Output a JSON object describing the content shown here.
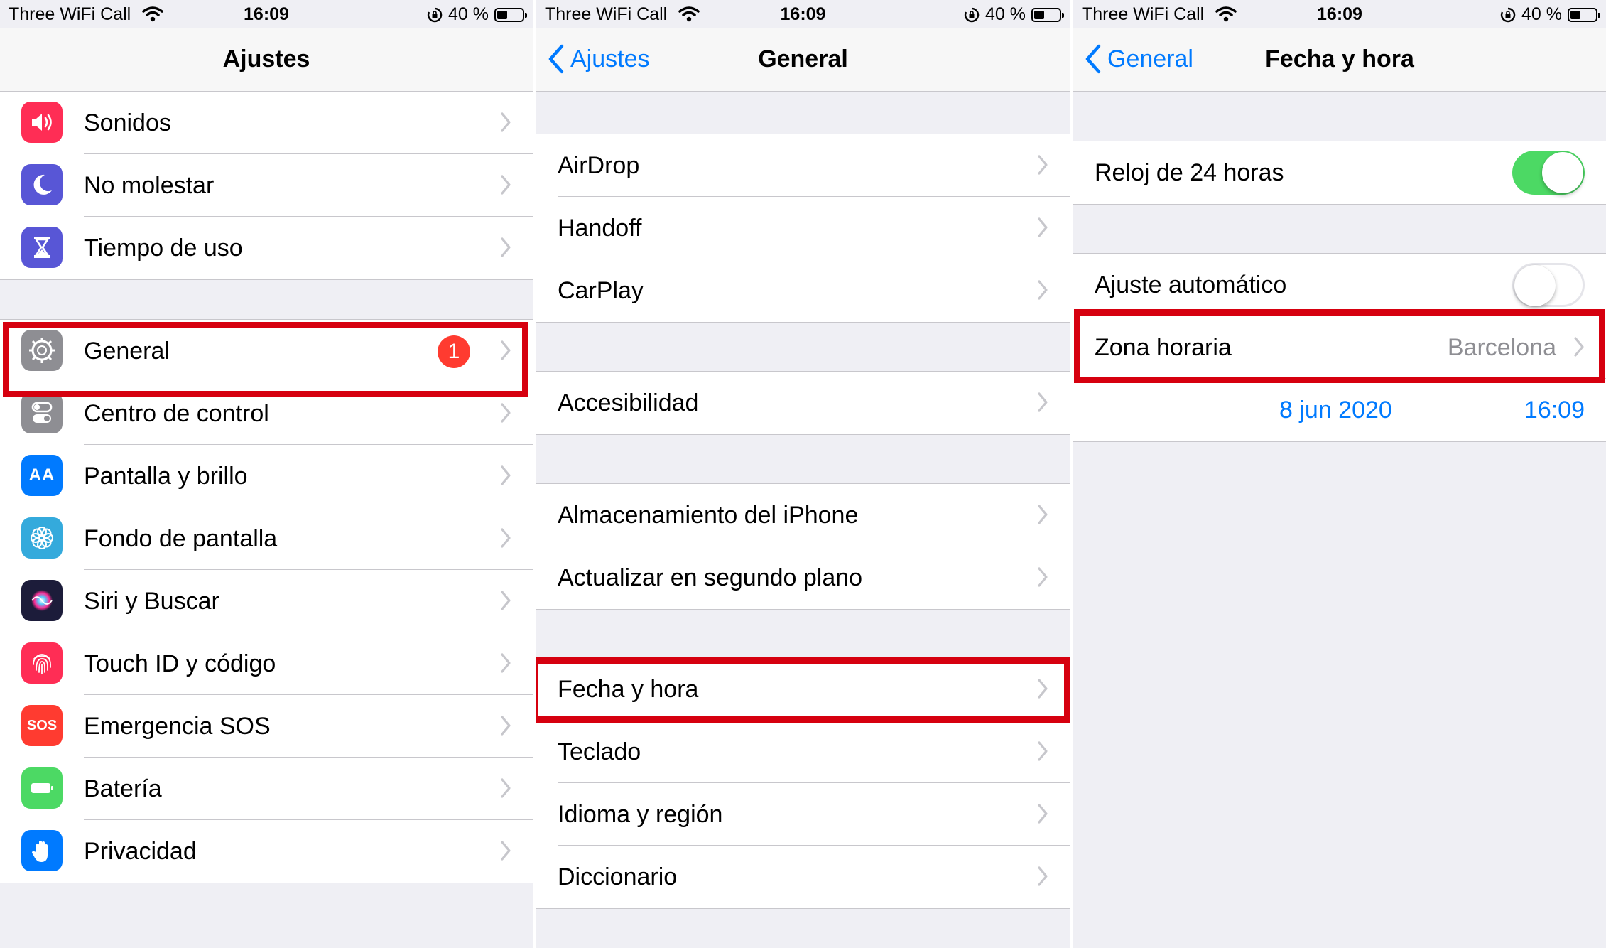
{
  "status": {
    "carrier": "Three WiFi Call",
    "time": "16:09",
    "battery": "40 %",
    "battery_level": 0.4
  },
  "screens": {
    "settings": {
      "title": "Ajustes",
      "group1": [
        {
          "label": "Sonidos",
          "icon": "speaker-icon",
          "color": "#ff2d55"
        },
        {
          "label": "No molestar",
          "icon": "moon-icon",
          "color": "#5856d6"
        },
        {
          "label": "Tiempo de uso",
          "icon": "hourglass-icon",
          "color": "#5856d6"
        }
      ],
      "group2": [
        {
          "label": "General",
          "icon": "gear-icon",
          "color": "#8e8e93",
          "badge": "1"
        },
        {
          "label": "Centro de control",
          "icon": "switches-icon",
          "color": "#8e8e93"
        },
        {
          "label": "Pantalla y brillo",
          "icon": "text-size-icon",
          "icon_text": "AA",
          "color": "#007aff"
        },
        {
          "label": "Fondo de pantalla",
          "icon": "flower-icon",
          "color": "#34aadc"
        },
        {
          "label": "Siri y Buscar",
          "icon": "siri-icon",
          "color": "#1c1c3a"
        },
        {
          "label": "Touch ID y código",
          "icon": "fingerprint-icon",
          "color": "#ff2d55"
        },
        {
          "label": "Emergencia SOS",
          "icon": "sos-icon",
          "icon_text": "SOS",
          "color": "#ff3b30"
        },
        {
          "label": "Batería",
          "icon": "battery-icon",
          "color": "#4cd964"
        },
        {
          "label": "Privacidad",
          "icon": "hand-icon",
          "color": "#007aff"
        }
      ]
    },
    "general": {
      "back": "Ajustes",
      "title": "General",
      "group1": [
        "AirDrop",
        "Handoff",
        "CarPlay"
      ],
      "group2": [
        "Accesibilidad"
      ],
      "group3": [
        "Almacenamiento del iPhone",
        "Actualizar en segundo plano"
      ],
      "group4": [
        "Fecha y hora",
        "Teclado",
        "Idioma y región",
        "Diccionario"
      ]
    },
    "datetime": {
      "back": "General",
      "title": "Fecha y hora",
      "clock24_label": "Reloj de 24 horas",
      "clock24_on": true,
      "auto_label": "Ajuste automático",
      "auto_on": false,
      "timezone_label": "Zona horaria",
      "timezone_value": "Barcelona",
      "date": "8 jun 2020",
      "time": "16:09"
    }
  },
  "colors": {
    "accent": "#007aff",
    "highlight": "#d6000f",
    "switch_on": "#4cd964",
    "badge": "#ff3b30"
  }
}
